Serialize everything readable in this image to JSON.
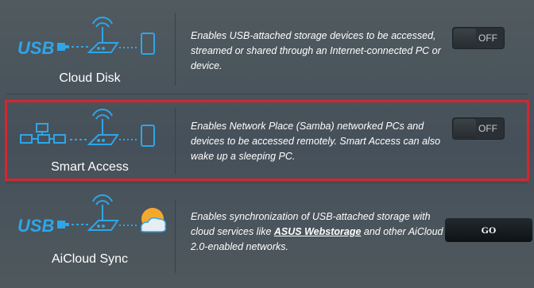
{
  "features": [
    {
      "title": "Cloud Disk",
      "description": "Enables USB-attached storage devices to be accessed, streamed or shared through an Internet-connected PC or device.",
      "control": "toggle",
      "control_label": "OFF",
      "icons": [
        "usb-logo-icon",
        "router-icon",
        "phone-icon"
      ]
    },
    {
      "title": "Smart Access",
      "description": "Enables Network Place (Samba) networked PCs and devices to be accessed remotely. Smart Access can also wake up a sleeping PC.",
      "control": "toggle",
      "control_label": "OFF",
      "highlighted": true,
      "icons": [
        "network-computers-icon",
        "router-icon",
        "phone-icon"
      ]
    },
    {
      "title": "AiCloud Sync",
      "description_parts": [
        "Enables synchronization of USB-attached storage with cloud services like ",
        "ASUS Webstorage",
        " and other AiCloud 2.0-enabled networks."
      ],
      "control": "button",
      "control_label": "GO",
      "icons": [
        "usb-logo-icon",
        "router-icon",
        "cloud-icon"
      ]
    }
  ],
  "colors": {
    "accent_blue": "#2ea6e8",
    "highlight_red": "#d0282f",
    "background": "#4a5358"
  }
}
